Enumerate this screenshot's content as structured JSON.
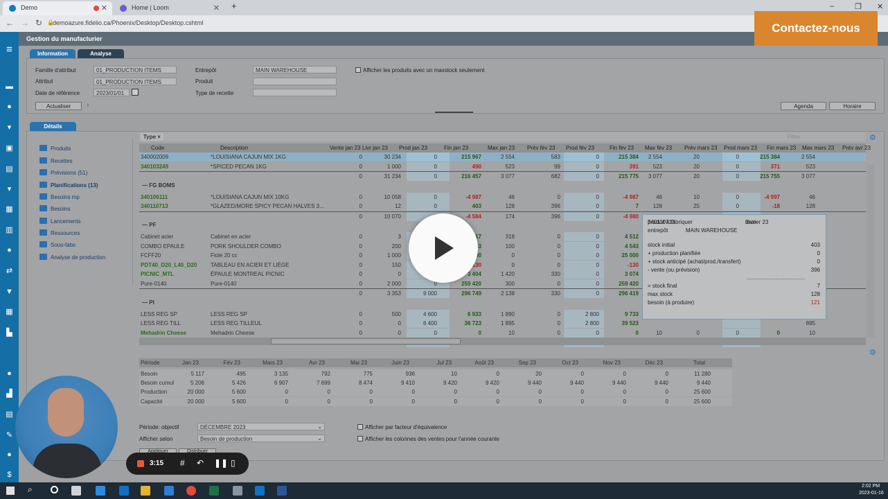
{
  "browser": {
    "tabs": [
      {
        "label": "Demo",
        "close": "✕"
      },
      {
        "label": "Home | Loom",
        "close": "✕"
      }
    ],
    "new_tab": "+",
    "url": "demoazure.fidelio.ca/Phoenix/Desktop/Desktop.cshtml",
    "window_controls": [
      "–",
      "❐",
      "✕"
    ]
  },
  "app": {
    "title": "Gestion du manufacturier",
    "top_tabs": [
      "Information",
      "Analyse"
    ],
    "filters": {
      "famille_label": "Famille d'attribut",
      "famille_value": "01_PRODUCTION ITEMS",
      "attribut_label": "Attribut",
      "attribut_value": "01_PRODUCTION ITEMS",
      "date_label": "Date de référence",
      "date_value": "2023/01/01",
      "entrepot_label": "Entrepôt",
      "entrepot_value": "MAIN WAREHOUSE",
      "produit_label": "Produit",
      "produit_value": "",
      "recette_label": "Type de recette",
      "recette_value": "",
      "maxstock_label": "Afficher les produits avec un maxstock seulement",
      "refresh_button": "Actualiser",
      "agenda_button": "Agenda",
      "horaire_button": "Horaire"
    },
    "details_tab": "Détails",
    "sidebar": [
      "Produits",
      "Recettes",
      "Prévisions (51)",
      "Planifications (13)",
      "Besoins mp",
      "Besoins",
      "Lancements",
      "Ressources",
      "Sous-fabs",
      "Analyse de production"
    ],
    "type_chip": "Type ×",
    "filter_placeholder": "Filtre",
    "columns": [
      "Code",
      "Description",
      "Vente jan 23",
      "Livr jan 23",
      "Prod jan 23",
      "Fin jan 23",
      "Max jan 23",
      "Prév fév 23",
      "Prod fév 23",
      "Fin fév 23",
      "Max fév 23",
      "Prév mars 23",
      "Prod mars 23",
      "Fin mars 23",
      "Max mars 23",
      "Prév avr 23"
    ],
    "rows": [
      {
        "kind": "data",
        "code": "340002009",
        "desc": "*LOUISIANA CAJUN MIX 1KG",
        "v": [
          "0",
          "30 234",
          "0",
          "215 967",
          "2 554",
          "583",
          "0",
          "215 384",
          "2 554",
          "20",
          "0",
          "215 384",
          "2 554",
          ""
        ],
        "sel": true
      },
      {
        "kind": "data",
        "code": "340103249",
        "desc": "*SPICED PECAN 1KG",
        "v": [
          "0",
          "1 000",
          "0",
          "490",
          "523",
          "99",
          "0",
          "391",
          "523",
          "20",
          "0",
          "371",
          "523",
          ""
        ],
        "green": true
      },
      {
        "kind": "total",
        "v": [
          "0",
          "31 234",
          "0",
          "216 457",
          "3 077",
          "682",
          "0",
          "215 775",
          "3 077",
          "20",
          "0",
          "215 755",
          "3 077",
          ""
        ]
      },
      {
        "kind": "group",
        "label": "FG BOMS"
      },
      {
        "kind": "data",
        "code": "340106111",
        "desc": "*LOUISIANA CAJUN MIX 10KG",
        "v": [
          "0",
          "10 058",
          "0",
          "-4 987",
          "46",
          "0",
          "0",
          "-4 987",
          "46",
          "10",
          "0",
          "-4 997",
          "46",
          ""
        ],
        "green": true
      },
      {
        "kind": "data",
        "code": "340110713",
        "desc": "*GLAZED/MORE SPICY PECAN HALVES 3...",
        "v": [
          "0",
          "12",
          "0",
          "403",
          "128",
          "396",
          "0",
          "7",
          "128",
          "25",
          "0",
          "-18",
          "128",
          ""
        ],
        "green": true
      },
      {
        "kind": "total",
        "v": [
          "0",
          "10 070",
          "0",
          "-4 584",
          "174",
          "396",
          "0",
          "-4 980",
          "174",
          "35",
          "0",
          "-5 015",
          "174",
          ""
        ]
      },
      {
        "kind": "group",
        "label": "PF"
      },
      {
        "kind": "data",
        "code": "Cabinet acier",
        "desc": "Cabinet en acier",
        "v": [
          "0",
          "3",
          "0",
          "417",
          "318",
          "0",
          "0",
          "4 512",
          "",
          "",
          "",
          "",
          "318",
          ""
        ]
      },
      {
        "kind": "data",
        "code": "COMBO EPAULE",
        "desc": "PORK SHOULDER COMBO",
        "v": [
          "0",
          "200",
          "0",
          "543",
          "100",
          "0",
          "0",
          "4 543",
          "",
          "",
          "",
          "",
          "100",
          ""
        ]
      },
      {
        "kind": "data",
        "code": "FCFF20",
        "desc": "Fiole 20 cc",
        "v": [
          "0",
          "1 000",
          "0",
          "25 000",
          "0",
          "0",
          "0",
          "25 000",
          "",
          "",
          "",
          "",
          "0",
          ""
        ]
      },
      {
        "kind": "data",
        "code": "PDT40_D20_L40_D20",
        "desc": "TABLEAU EN ACIER ET LIÈGE",
        "v": [
          "0",
          "150",
          "0",
          "-130",
          "0",
          "0",
          "0",
          "-130",
          "",
          "",
          "",
          "",
          "0",
          ""
        ],
        "green": true
      },
      {
        "kind": "data",
        "code": "PICNIC_MTL",
        "desc": "ÉPAULE MONTREAL PICNIC",
        "v": [
          "0",
          "0",
          "0",
          "3 404",
          "1 420",
          "330",
          "0",
          "3 074",
          "",
          "",
          "",
          "",
          "420",
          ""
        ],
        "green": true
      },
      {
        "kind": "data",
        "code": "Pure-0140",
        "desc": "Pure-0140",
        "v": [
          "0",
          "2 000",
          "0",
          "259 420",
          "300",
          "0",
          "0",
          "259 420",
          "",
          "",
          "",
          "",
          "0",
          ""
        ]
      },
      {
        "kind": "total",
        "v": [
          "0",
          "3 353",
          "9 000",
          "296 749",
          "2 138",
          "330",
          "0",
          "296 419",
          "",
          "",
          "",
          "",
          "138",
          ""
        ]
      },
      {
        "kind": "group",
        "label": "PI"
      },
      {
        "kind": "data",
        "code": "LESS REG SP",
        "desc": "LESS REG SP",
        "v": [
          "0",
          "500",
          "4 600",
          "6 933",
          "1 890",
          "0",
          "2 800",
          "9 733",
          "",
          "",
          "",
          "",
          "890",
          ""
        ]
      },
      {
        "kind": "data",
        "code": "LESS REG TILL",
        "desc": "LESS REG TILLEUL",
        "v": [
          "0",
          "0",
          "6 400",
          "36 723",
          "1 895",
          "0",
          "2 800",
          "39 523",
          "",
          "",
          "",
          "",
          "895",
          ""
        ]
      },
      {
        "kind": "data",
        "code": "Mehadrin Cheese",
        "desc": "Mehadrin Cheese",
        "v": [
          "0",
          "0",
          "0",
          "0",
          "10",
          "0",
          "0",
          "0",
          "10",
          "0",
          "0",
          "0",
          "10",
          ""
        ],
        "green": true
      },
      {
        "kind": "total",
        "v": [
          "0",
          "500",
          "11 000",
          "43 656",
          "3 795",
          "0",
          "5 600",
          "49 256",
          "3 795",
          "0",
          "0",
          "49 256",
          "3 795",
          ""
        ]
      }
    ],
    "tooltip": {
      "produit_label": "produit à fabriquer",
      "produit_value": "340110713",
      "date_label": "date",
      "date_value": "février 23",
      "entrepot_label": "entrepôt",
      "entrepot_value": "MAIN WAREHOUSE",
      "lines": [
        [
          "stock initial",
          "403"
        ],
        [
          "+ production planifiée",
          "0"
        ],
        [
          "+ stock anticipé (achat/prod./transfert)",
          "0"
        ],
        [
          "- vente (ou prévision)",
          "396"
        ]
      ],
      "separator": "--------------------------------",
      "final": [
        [
          "= stock final",
          "7"
        ],
        [
          "max stock",
          "128"
        ],
        [
          "besoin (à produire)",
          "121"
        ]
      ]
    },
    "summary": {
      "headers": [
        "Période",
        "Jan 23",
        "Fév 23",
        "Mars 23",
        "Avr 23",
        "Mai 23",
        "Juin 23",
        "Jul 23",
        "Août 23",
        "Sep 23",
        "Oct 23",
        "Nov 23",
        "Déc 23",
        "Total"
      ],
      "rows": [
        [
          "Besoin",
          "5 117",
          "495",
          "3 135",
          "792",
          "775",
          "936",
          "10",
          "0",
          "20",
          "0",
          "0",
          "0",
          "11 280"
        ],
        [
          "Besoin cumul",
          "5 206",
          "5 426",
          "6 907",
          "7 699",
          "8 474",
          "9 410",
          "9 420",
          "9 420",
          "9 440",
          "9 440",
          "9 440",
          "9 440",
          "9 440"
        ],
        [
          "Production",
          "20 000",
          "5 600",
          "0",
          "0",
          "0",
          "0",
          "0",
          "0",
          "0",
          "0",
          "0",
          "0",
          "25 600"
        ],
        [
          "Capacité",
          "20 000",
          "5 600",
          "0",
          "0",
          "0",
          "0",
          "0",
          "0",
          "0",
          "0",
          "0",
          "0",
          "25 600"
        ]
      ]
    },
    "bottom": {
      "periode_label": "Période: objectif",
      "periode_value": "DÉCEMBRE 2023",
      "afficher_label": "Afficher selon",
      "afficher_value": "Besoin de production",
      "chk1": "Afficher par facteur d'équivalence",
      "chk2": "Afficher les colonnes des ventes pour l'année courante",
      "btn1": "Appliquer",
      "btn2": "Distribuer"
    }
  },
  "cta": "Contactez-nous",
  "recorder": {
    "time": "3:15"
  },
  "clock": {
    "time": "2:02 PM",
    "date": "2023-01-16"
  },
  "colors": {
    "nav": "#136fa6",
    "cta": "#d9862e",
    "green_code": "#2e6b1e",
    "red_value": "#b02020"
  }
}
